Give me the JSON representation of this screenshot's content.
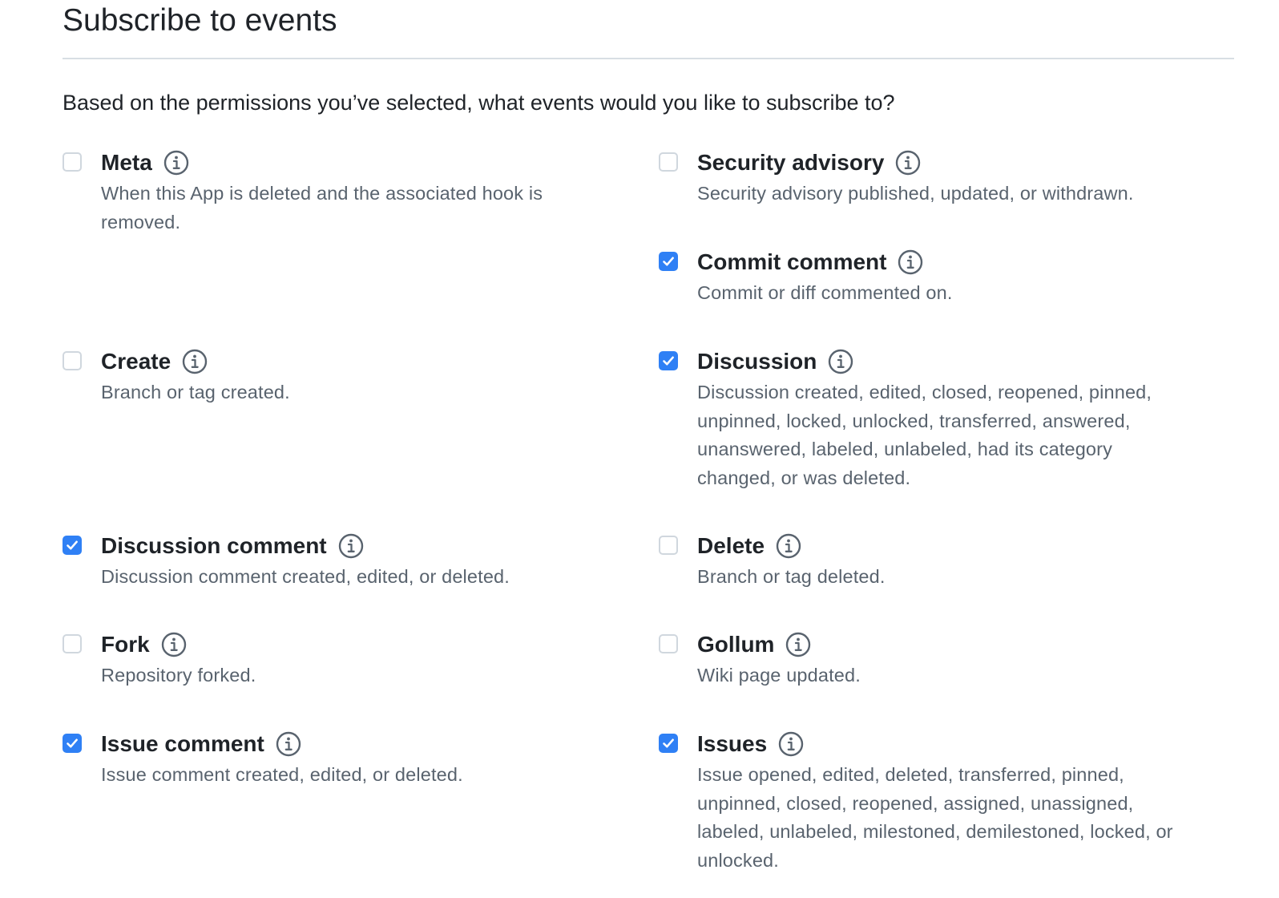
{
  "section": {
    "title": "Subscribe to events",
    "intro": "Based on the permissions you’ve selected, what events would you like to subscribe to?"
  },
  "colors": {
    "accent": "#2f80f5",
    "text": "#1f2328",
    "muted": "#59636e",
    "border": "#d0d7de"
  },
  "events": {
    "meta": {
      "name": "Meta",
      "checked": false,
      "desc_lines": [
        "When this App is deleted and the associated hook is",
        "removed."
      ]
    },
    "security_advisory": {
      "name": "Security advisory",
      "checked": false,
      "desc_lines": [
        "Security advisory published, updated, or withdrawn."
      ]
    },
    "commit_comment": {
      "name": "Commit comment",
      "checked": true,
      "desc_lines": [
        "Commit or diff commented on."
      ]
    },
    "create": {
      "name": "Create",
      "checked": false,
      "desc_lines": [
        "Branch or tag created."
      ]
    },
    "discussion": {
      "name": "Discussion",
      "checked": true,
      "desc_lines": [
        "Discussion created, edited, closed, reopened, pinned,",
        "unpinned, locked, unlocked, transferred, answered,",
        "unanswered, labeled, unlabeled, had its category",
        "changed, or was deleted."
      ]
    },
    "discussion_comment": {
      "name": "Discussion comment",
      "checked": true,
      "desc_lines": [
        "Discussion comment created, edited, or deleted."
      ]
    },
    "delete": {
      "name": "Delete",
      "checked": false,
      "desc_lines": [
        "Branch or tag deleted."
      ]
    },
    "fork": {
      "name": "Fork",
      "checked": false,
      "desc_lines": [
        "Repository forked."
      ]
    },
    "gollum": {
      "name": "Gollum",
      "checked": false,
      "desc_lines": [
        "Wiki page updated."
      ]
    },
    "issue_comment": {
      "name": "Issue comment",
      "checked": true,
      "desc_lines": [
        "Issue comment created, edited, or deleted."
      ]
    },
    "issues": {
      "name": "Issues",
      "checked": true,
      "desc_lines": [
        "Issue opened, edited, deleted, transferred, pinned,",
        "unpinned, closed, reopened, assigned, unassigned,",
        "labeled, unlabeled, milestoned, demilestoned, locked, or",
        "unlocked."
      ]
    }
  }
}
